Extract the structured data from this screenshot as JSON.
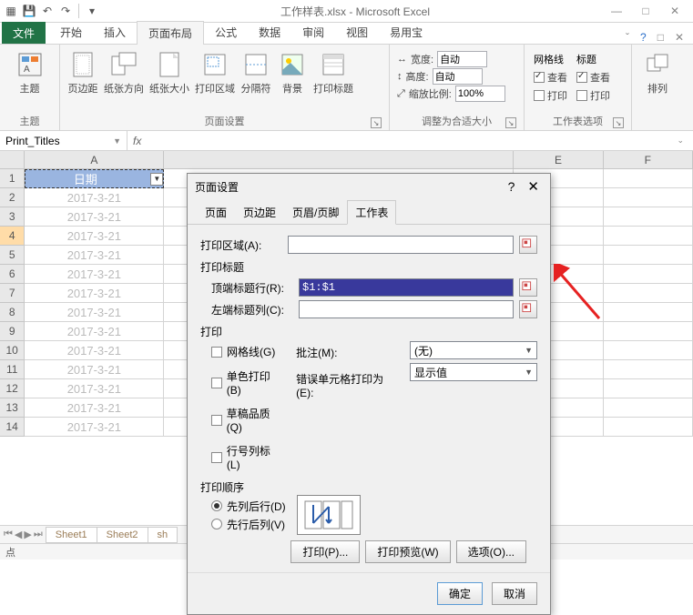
{
  "titlebar": {
    "title": "工作样表.xlsx - Microsoft Excel"
  },
  "ribbon": {
    "file": "文件",
    "tabs": [
      "开始",
      "插入",
      "页面布局",
      "公式",
      "数据",
      "审阅",
      "视图",
      "易用宝"
    ],
    "active": "页面布局",
    "groups": {
      "themes": {
        "label": "主题",
        "btn": "主题"
      },
      "page_setup": {
        "label": "页面设置",
        "items": [
          "页边距",
          "纸张方向",
          "纸张大小",
          "打印区域",
          "分隔符",
          "背景",
          "打印标题"
        ]
      },
      "scale": {
        "label": "调整为合适大小",
        "width_label": "宽度:",
        "width_value": "自动",
        "height_label": "高度:",
        "height_value": "自动",
        "scale_label": "缩放比例:",
        "scale_value": "100%"
      },
      "sheet_opts": {
        "label": "工作表选项",
        "grid_title": "网格线",
        "title_title": "标题",
        "view": "查看",
        "print": "打印"
      },
      "arrange": {
        "label": "排列",
        "btn": "排列"
      }
    }
  },
  "name_box": "Print_Titles",
  "columns": [
    "A",
    "E",
    "F"
  ],
  "rows": [
    {
      "n": 1,
      "a": "日期",
      "header": true
    },
    {
      "n": 2,
      "a": "2017-3-21"
    },
    {
      "n": 3,
      "a": "2017-3-21"
    },
    {
      "n": 4,
      "a": "2017-3-21",
      "active": true
    },
    {
      "n": 5,
      "a": "2017-3-21"
    },
    {
      "n": 6,
      "a": "2017-3-21"
    },
    {
      "n": 7,
      "a": "2017-3-21"
    },
    {
      "n": 8,
      "a": "2017-3-21"
    },
    {
      "n": 9,
      "a": "2017-3-21"
    },
    {
      "n": 10,
      "a": "2017-3-21"
    },
    {
      "n": 11,
      "a": "2017-3-21"
    },
    {
      "n": 12,
      "a": "2017-3-21"
    },
    {
      "n": 13,
      "a": "2017-3-21"
    },
    {
      "n": 14,
      "a": "2017-3-21"
    }
  ],
  "sheet_tabs": [
    "Sheet1",
    "Sheet2",
    "sh"
  ],
  "status": "点",
  "dialog": {
    "title": "页面设置",
    "tabs": [
      "页面",
      "页边距",
      "页眉/页脚",
      "工作表"
    ],
    "active_tab": "工作表",
    "print_area_label": "打印区域(A):",
    "print_titles_label": "打印标题",
    "top_rows_label": "顶端标题行(R):",
    "top_rows_value": "$1:$1",
    "left_cols_label": "左端标题列(C):",
    "print_label": "打印",
    "gridlines": "网格线(G)",
    "bw": "单色打印(B)",
    "draft": "草稿品质(Q)",
    "row_col_headings": "行号列标(L)",
    "comments_label": "批注(M):",
    "comments_value": "(无)",
    "errors_label": "错误单元格打印为(E):",
    "errors_value": "显示值",
    "order_label": "打印顺序",
    "order_down": "先列后行(D)",
    "order_over": "先行后列(V)",
    "btn_print": "打印(P)...",
    "btn_preview": "打印预览(W)",
    "btn_options": "选项(O)...",
    "ok": "确定",
    "cancel": "取消"
  }
}
